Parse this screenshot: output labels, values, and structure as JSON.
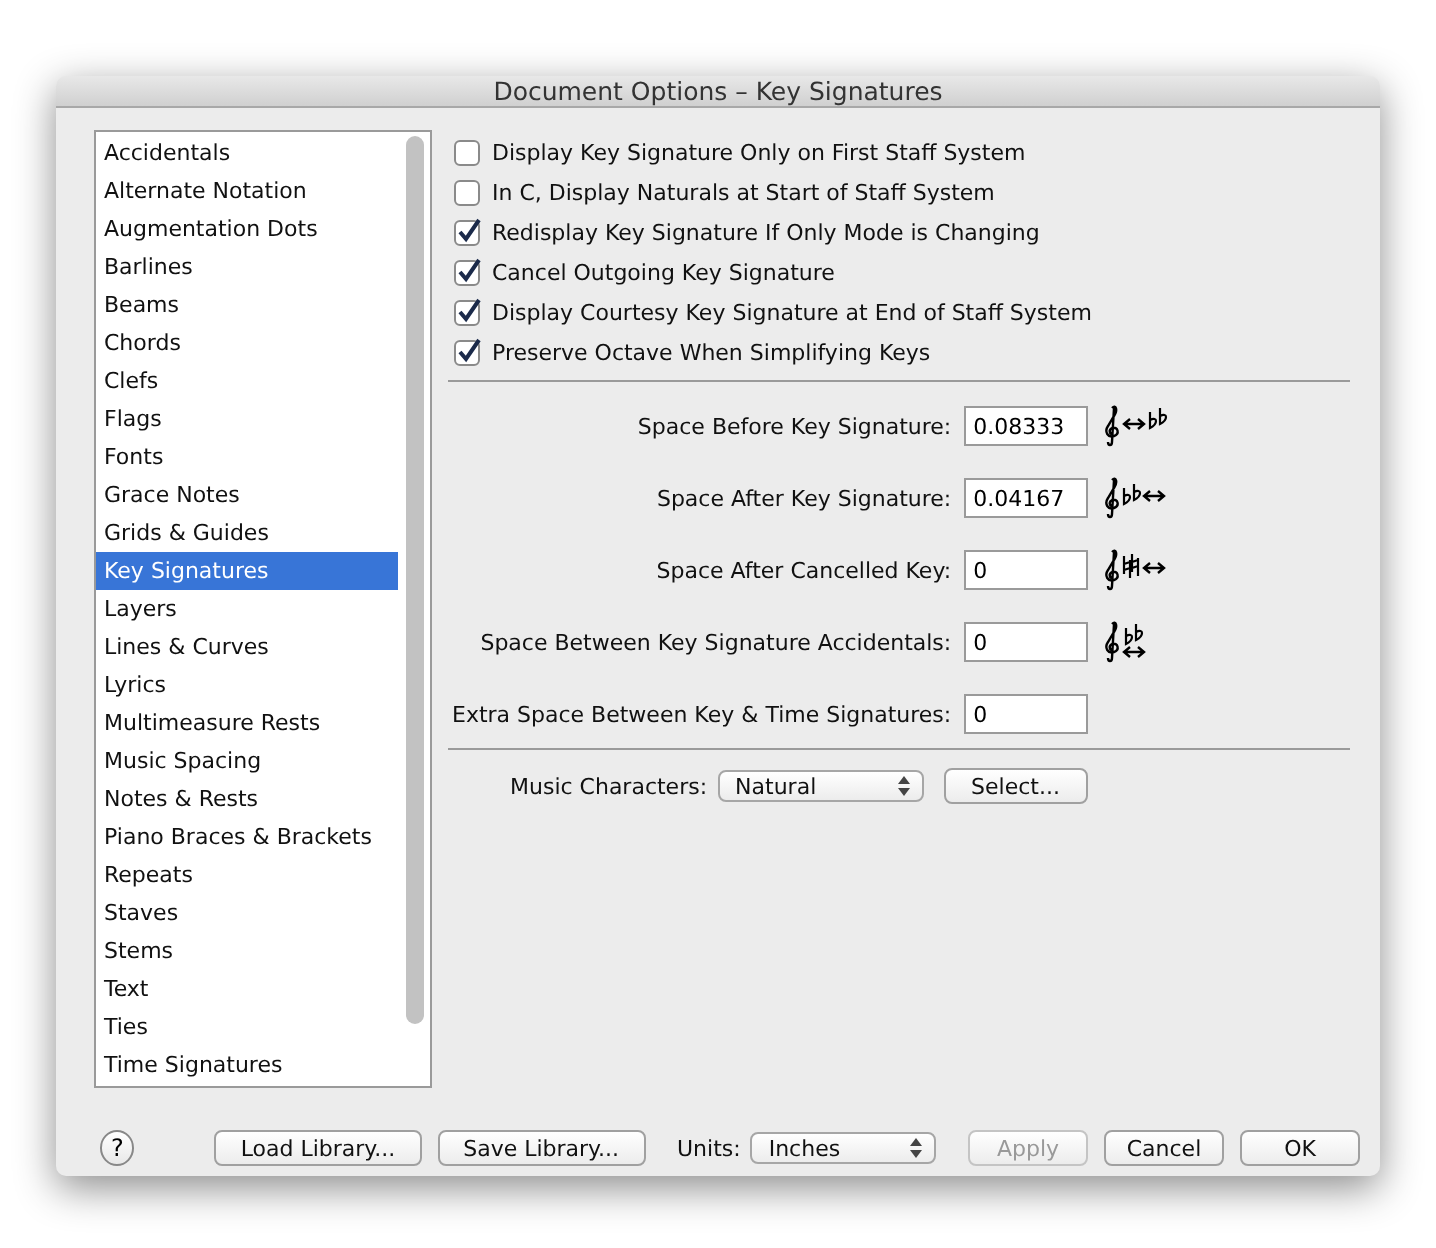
{
  "window": {
    "title": "Document Options – Key Signatures"
  },
  "categories": [
    {
      "label": "Accidentals",
      "selected": false
    },
    {
      "label": "Alternate Notation",
      "selected": false
    },
    {
      "label": "Augmentation Dots",
      "selected": false
    },
    {
      "label": "Barlines",
      "selected": false
    },
    {
      "label": "Beams",
      "selected": false
    },
    {
      "label": "Chords",
      "selected": false
    },
    {
      "label": "Clefs",
      "selected": false
    },
    {
      "label": "Flags",
      "selected": false
    },
    {
      "label": "Fonts",
      "selected": false
    },
    {
      "label": "Grace Notes",
      "selected": false
    },
    {
      "label": "Grids & Guides",
      "selected": false
    },
    {
      "label": "Key Signatures",
      "selected": true
    },
    {
      "label": "Layers",
      "selected": false
    },
    {
      "label": "Lines & Curves",
      "selected": false
    },
    {
      "label": "Lyrics",
      "selected": false
    },
    {
      "label": "Multimeasure Rests",
      "selected": false
    },
    {
      "label": "Music Spacing",
      "selected": false
    },
    {
      "label": "Notes & Rests",
      "selected": false
    },
    {
      "label": "Piano Braces & Brackets",
      "selected": false
    },
    {
      "label": "Repeats",
      "selected": false
    },
    {
      "label": "Staves",
      "selected": false
    },
    {
      "label": "Stems",
      "selected": false
    },
    {
      "label": "Text",
      "selected": false
    },
    {
      "label": "Ties",
      "selected": false
    },
    {
      "label": "Time Signatures",
      "selected": false
    }
  ],
  "options": [
    {
      "label": "Display Key Signature Only on First Staff System",
      "checked": false
    },
    {
      "label": "In C, Display Naturals at Start of Staff System",
      "checked": false
    },
    {
      "label": "Redisplay Key Signature If Only Mode is Changing",
      "checked": true
    },
    {
      "label": "Cancel Outgoing Key Signature",
      "checked": true
    },
    {
      "label": "Display Courtesy Key Signature at End of Staff System",
      "checked": true
    },
    {
      "label": "Preserve Octave When Simplifying Keys",
      "checked": true
    }
  ],
  "spacing": [
    {
      "label": "Space Before Key Signature:",
      "value": "0.08333",
      "kind": "before"
    },
    {
      "label": "Space After Key Signature:",
      "value": "0.04167",
      "kind": "after"
    },
    {
      "label": "Space After Cancelled Key:",
      "value": "0",
      "kind": "cancelled"
    },
    {
      "label": "Space Between Key Signature Accidentals:",
      "value": "0",
      "kind": "between"
    },
    {
      "label": "Extra Space Between Key & Time Signatures:",
      "value": "0",
      "kind": "none"
    }
  ],
  "music_characters": {
    "label": "Music Characters:",
    "value": "Natural",
    "button": "Select..."
  },
  "footer": {
    "help": "?",
    "load": "Load Library...",
    "save": "Save Library...",
    "units_label": "Units:",
    "units": "Inches",
    "buttons": [
      {
        "label": "Apply",
        "disabled": true
      },
      {
        "label": "Cancel",
        "disabled": false
      },
      {
        "label": "OK",
        "disabled": false
      }
    ]
  }
}
